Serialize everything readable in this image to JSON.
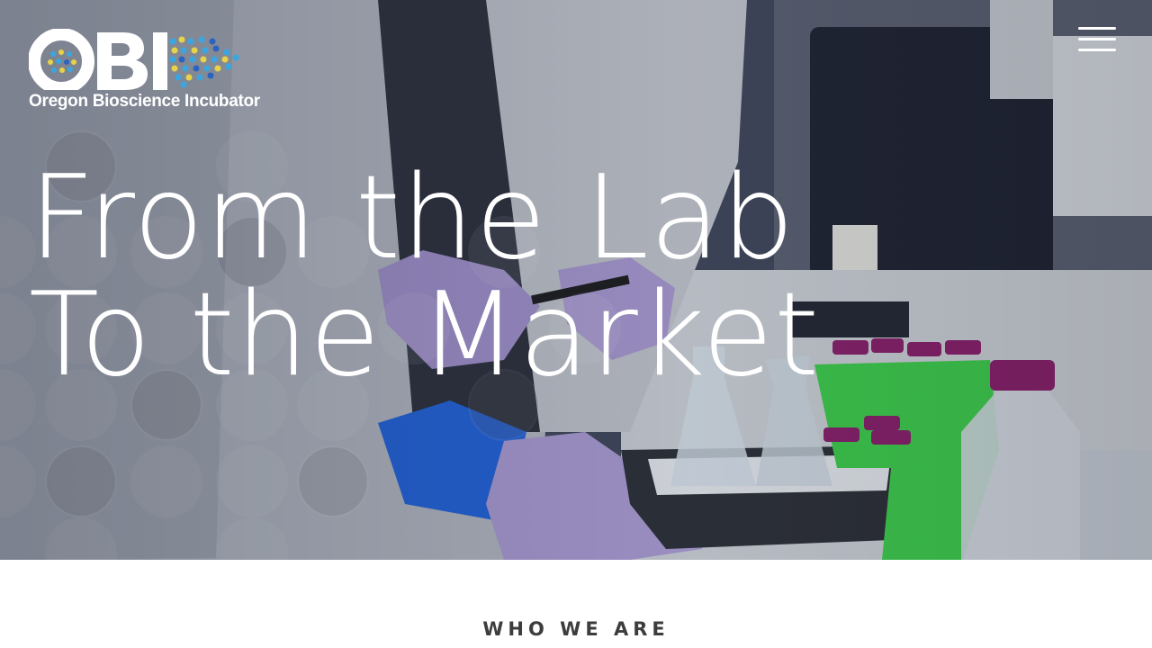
{
  "logo": {
    "wordmark": "OBI",
    "tagline": "Oregon Bioscience Incubator"
  },
  "nav": {
    "menu_icon": "hamburger-icon"
  },
  "hero": {
    "headline_line1": "From the Lab",
    "headline_line2": "To the Market"
  },
  "section": {
    "heading": "WHO WE ARE"
  },
  "colors": {
    "hero_text": "#ffffff",
    "heading_text": "#3d3d3d",
    "glove": "#a896d0",
    "cuff": "#1e63e0",
    "rack": "#3fd14a",
    "cap": "#8a1e6a",
    "logo_dot_blue": "#3aa6e0",
    "logo_dot_yellow": "#e6d34a"
  }
}
